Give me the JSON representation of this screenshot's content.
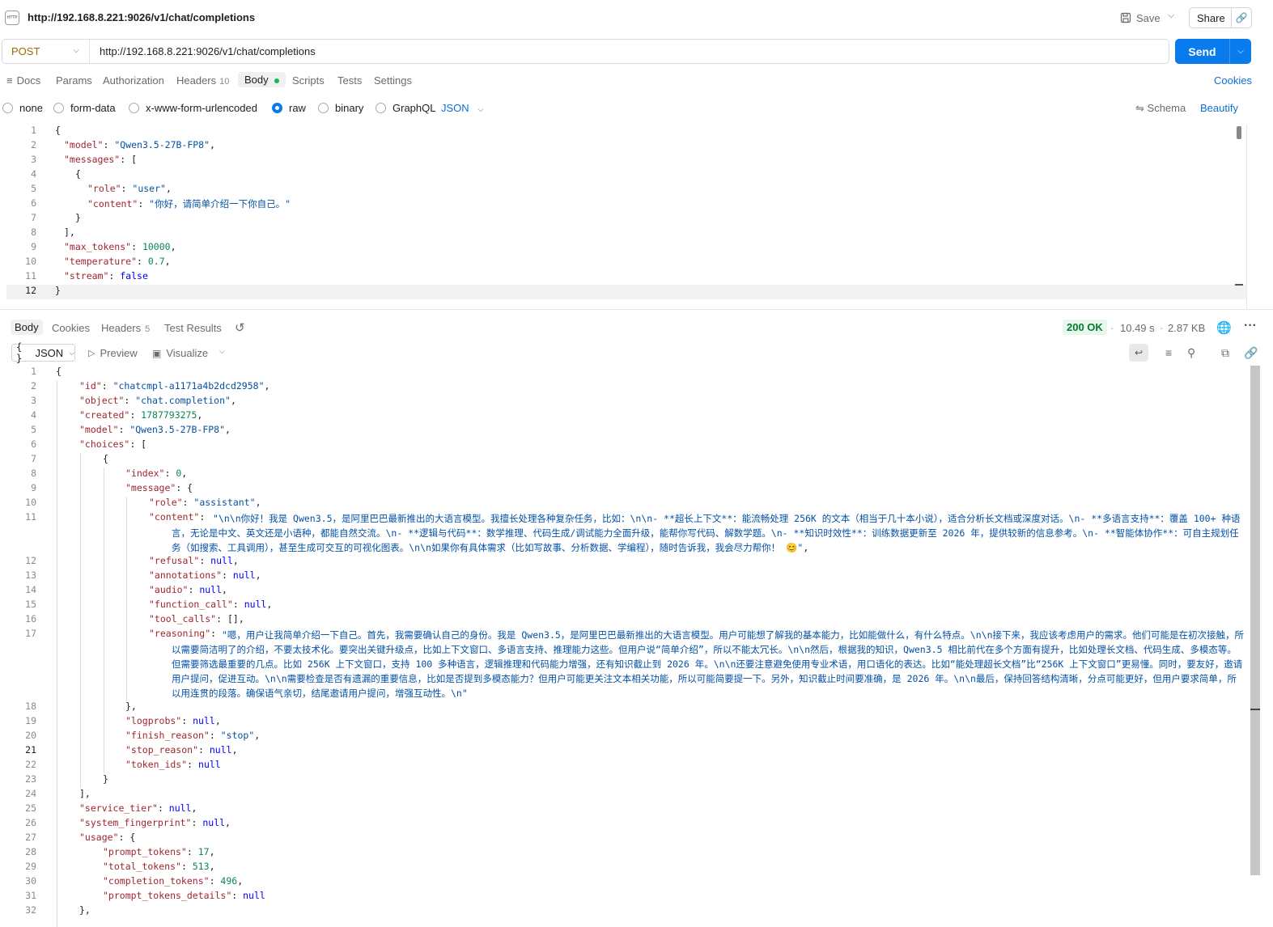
{
  "tab": {
    "title": "http://192.168.8.221:9026/v1/chat/completions"
  },
  "toolbar": {
    "save_label": "Save",
    "share_label": "Share"
  },
  "request": {
    "method": "POST",
    "url": "http://192.168.8.221:9026/v1/chat/completions",
    "send_label": "Send"
  },
  "req_tabs": {
    "docs": "Docs",
    "params": "Params",
    "authorization": "Authorization",
    "headers": "Headers",
    "headers_count": "10",
    "body": "Body",
    "scripts": "Scripts",
    "tests": "Tests",
    "settings": "Settings",
    "cookies": "Cookies"
  },
  "body_types": {
    "none": "none",
    "form_data": "form-data",
    "urlencoded": "x-www-form-urlencoded",
    "raw": "raw",
    "binary": "binary",
    "graphql": "GraphQL",
    "format": "JSON",
    "schema": "Schema",
    "beautify": "Beautify"
  },
  "request_body": {
    "line_numbers": [
      "1",
      "2",
      "3",
      "4",
      "5",
      "6",
      "7",
      "8",
      "9",
      "10",
      "11",
      "12"
    ],
    "l1": "{",
    "l2_key": "\"model\"",
    "l2_val": "\"Qwen3.5-27B-FP8\"",
    "l3_key": "\"messages\"",
    "l3_rest": ": [",
    "l4": "{",
    "l5_key": "\"role\"",
    "l5_val": "\"user\"",
    "l6_key": "\"content\"",
    "l6_val": "\"你好，请简单介绍一下你自己。\"",
    "l7": "}",
    "l8": "],",
    "l9_key": "\"max_tokens\"",
    "l9_val": "10000",
    "l10_key": "\"temperature\"",
    "l10_val": "0.7",
    "l11_key": "\"stream\"",
    "l11_val": "false",
    "l12": "}"
  },
  "resp_tabs": {
    "body": "Body",
    "cookies": "Cookies",
    "headers": "Headers",
    "headers_count": "5",
    "test_results": "Test Results",
    "status": "200 OK",
    "time": "10.49 s",
    "size": "2.87 KB"
  },
  "view": {
    "format": "JSON",
    "preview": "Preview",
    "visualize": "Visualize"
  },
  "response_body": {
    "id_key": "\"id\"",
    "id_val": "\"chatcmpl-a1171a4b2dcd2958\"",
    "object_key": "\"object\"",
    "object_val": "\"chat.completion\"",
    "created_key": "\"created\"",
    "created_val": "1787793275",
    "model_key": "\"model\"",
    "model_val": "\"Qwen3.5-27B-FP8\"",
    "choices_key": "\"choices\"",
    "index_key": "\"index\"",
    "index_val": "0",
    "message_key": "\"message\"",
    "role_key": "\"role\"",
    "role_val": "\"assistant\"",
    "content_key": "\"content\"",
    "content_val": "\"\\n\\n你好！我是 Qwen3.5，是阿里巴巴最新推出的大语言模型。我擅长处理各种复杂任务，比如：\\n\\n- **超长上下文**：能流畅处理 256K 的文本（相当于几十本小说），适合分析长文档或深度对话。\\n- **多语言支持**：覆盖 100+ 种语言，无论是中文、英文还是小语种，都能自然交流。\\n- **逻辑与代码**：数学推理、代码生成/调试能力全面升级，能帮你写代码、解数学题。\\n- **知识时效性**：训练数据更新至 2026 年，提供较新的信息参考。\\n- **智能体协作**：可自主规划任务（如搜索、工具调用），甚至生成可交互的可视化图表。\\n\\n如果你有具体需求（比如写故事、分析数据、学编程），随时告诉我，我会尽力帮你！ 😊\"",
    "refusal_key": "\"refusal\"",
    "annotations_key": "\"annotations\"",
    "audio_key": "\"audio\"",
    "function_call_key": "\"function_call\"",
    "tool_calls_key": "\"tool_calls\"",
    "tool_calls_val": "[]",
    "reasoning_key": "\"reasoning\"",
    "reasoning_val": "\"嗯，用户让我简单介绍一下自己。首先，我需要确认自己的身份。我是 Qwen3.5，是阿里巴巴最新推出的大语言模型。用户可能想了解我的基本能力，比如能做什么，有什么特点。\\n\\n接下来，我应该考虑用户的需求。他们可能是在初次接触，所以需要简洁明了的介绍，不要太技术化。要突出关键升级点，比如上下文窗口、多语言支持、推理能力这些。但用户说“简单介绍”，所以不能太冗长。\\n\\n然后，根据我的知识，Qwen3.5 相比前代在多个方面有提升，比如处理长文档、代码生成、多模态等。但需要筛选最重要的几点。比如 256K 上下文窗口，支持 100 多种语言，逻辑推理和代码能力增强，还有知识截止到 2026 年。\\n\\n还要注意避免使用专业术语，用口语化的表达。比如“能处理超长文档”比“256K 上下文窗口”更易懂。同时，要友好，邀请用户提问，促进互动。\\n\\n需要检查是否有遗漏的重要信息，比如是否提到多模态能力？但用户可能更关注文本相关功能，所以可能简要提一下。另外，知识截止时间要准确，是 2026 年。\\n\\n最后，保持回答结构清晰，分点可能更好，但用户要求简单，所以用连贯的段落。确保语气亲切，结尾邀请用户提问，增强互动性。\\n\"",
    "logprobs_key": "\"logprobs\"",
    "finish_reason_key": "\"finish_reason\"",
    "finish_reason_val": "\"stop\"",
    "stop_reason_key": "\"stop_reason\"",
    "token_ids_key": "\"token_ids\"",
    "service_tier_key": "\"service_tier\"",
    "system_fingerprint_key": "\"system_fingerprint\"",
    "usage_key": "\"usage\"",
    "prompt_tokens_key": "\"prompt_tokens\"",
    "prompt_tokens_val": "17",
    "total_tokens_key": "\"total_tokens\"",
    "total_tokens_val": "513",
    "completion_tokens_key": "\"completion_tokens\"",
    "completion_tokens_val": "496",
    "prompt_tokens_details_key": "\"prompt_tokens_details\"",
    "null": "null"
  },
  "colors": {
    "accent": "#097bed",
    "json_key": "#a02530",
    "json_string": "#0451a5",
    "json_number": "#098658",
    "json_keyword": "#0000ff",
    "status_ok": "#067a31",
    "method": "#a36a00"
  },
  "icons": [
    "http-icon",
    "save-icon",
    "chevron-down-icon",
    "link-icon",
    "docs-icon",
    "history-icon",
    "globe-icon",
    "more-icon",
    "play-icon",
    "image-icon",
    "wrap-icon",
    "filter-icon",
    "search-icon",
    "copy-icon",
    "schema-icon"
  ]
}
